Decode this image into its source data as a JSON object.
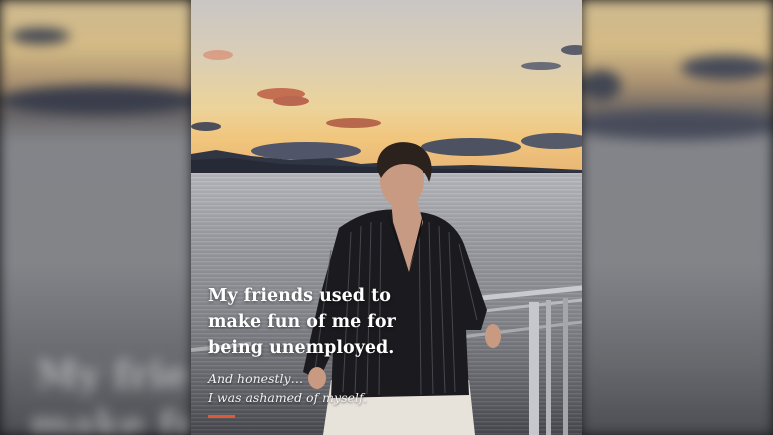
{
  "caption": {
    "title_lines": [
      "My friends used to",
      "make fun of me for",
      "being unemployed."
    ],
    "subtitle_lines": [
      "And honestly…",
      "I was ashamed of myself."
    ]
  },
  "colors": {
    "accent": "#e0573a",
    "sky_top": "#c9c6c4",
    "sunset": "#f1c57c",
    "water": "#9a9ca2",
    "shirt": "#1b1b1f"
  }
}
